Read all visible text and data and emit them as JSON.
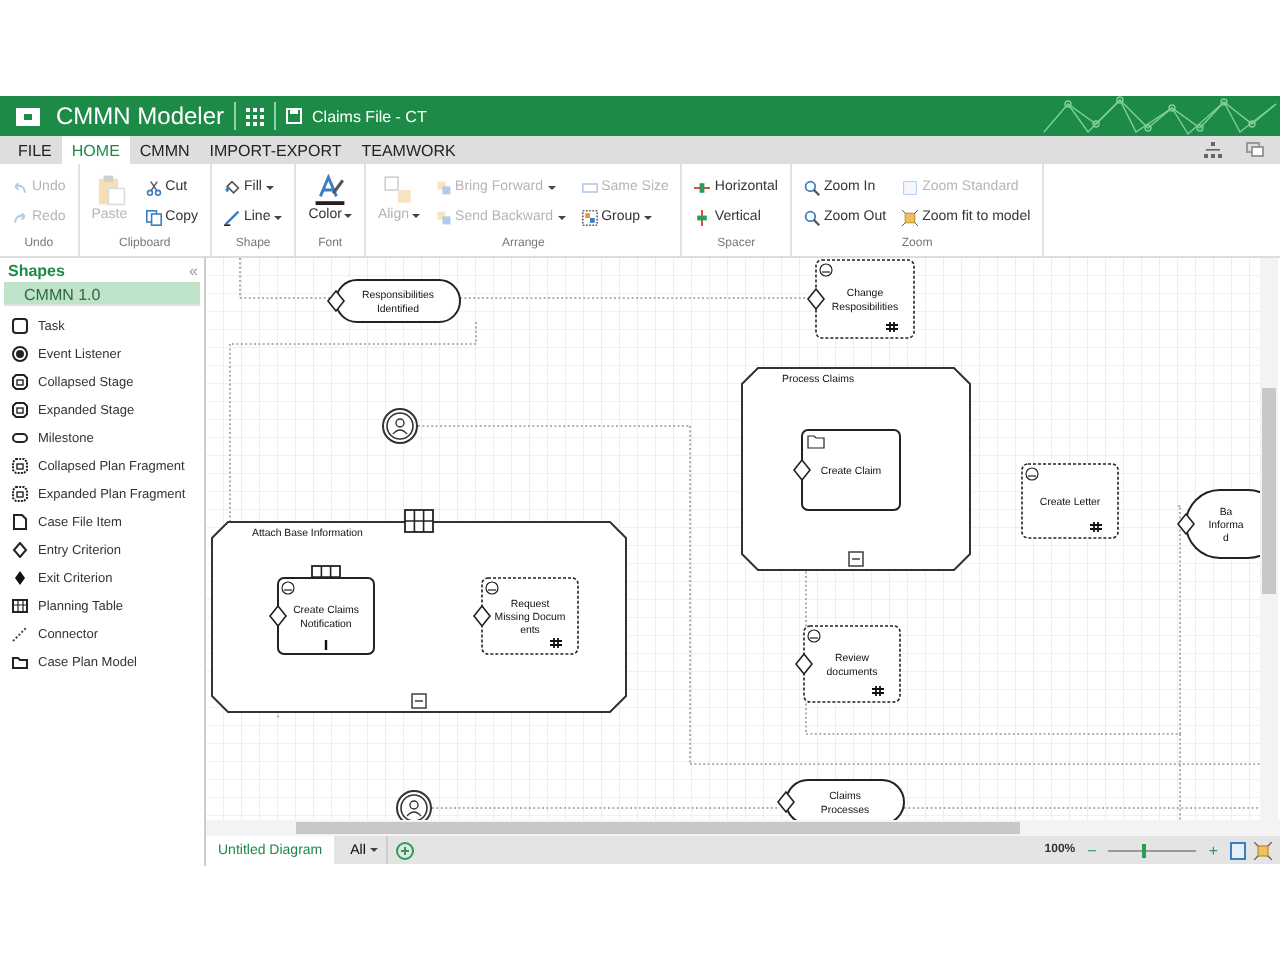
{
  "app": {
    "title": "CMMN Modeler",
    "document": "Claims File - CT"
  },
  "menu": [
    {
      "label": "FILE",
      "selected": false
    },
    {
      "label": "HOME",
      "selected": true
    },
    {
      "label": "CMMN",
      "selected": false
    },
    {
      "label": "IMPORT-EXPORT",
      "selected": false
    },
    {
      "label": "TEAMWORK",
      "selected": false
    }
  ],
  "ribbon": [
    {
      "label": "Undo",
      "columns": [
        [
          {
            "label": "Undo",
            "kind": "small",
            "dropdown": false,
            "disabled": true
          },
          {
            "label": "Redo",
            "kind": "small",
            "dropdown": false,
            "disabled": true
          }
        ]
      ]
    },
    {
      "label": "Clipboard",
      "columns": [
        [
          {
            "label": "Paste",
            "kind": "large",
            "dropdown": false,
            "disabled": true
          }
        ],
        [
          {
            "label": "Cut",
            "kind": "small",
            "dropdown": false,
            "disabled": false
          },
          {
            "label": "Copy",
            "kind": "small",
            "dropdown": false,
            "disabled": false
          }
        ]
      ]
    },
    {
      "label": "Shape",
      "columns": [
        [
          {
            "label": "Fill",
            "kind": "small",
            "dropdown": true,
            "disabled": false
          },
          {
            "label": "Line",
            "kind": "small",
            "dropdown": true,
            "disabled": false
          }
        ]
      ]
    },
    {
      "label": "Font",
      "columns": [
        [
          {
            "label": "Color",
            "kind": "large",
            "dropdown": true,
            "disabled": false
          }
        ]
      ]
    },
    {
      "label": "Arrange",
      "columns": [
        [
          {
            "label": "Align",
            "kind": "large",
            "dropdown": true,
            "disabled": true
          }
        ],
        [
          {
            "label": "Bring Forward",
            "kind": "small",
            "dropdown": true,
            "disabled": true
          },
          {
            "label": "Send Backward",
            "kind": "small",
            "dropdown": true,
            "disabled": true
          }
        ],
        [
          {
            "label": "Same Size",
            "kind": "small",
            "dropdown": false,
            "disabled": true
          },
          {
            "label": "Group",
            "kind": "small",
            "dropdown": true,
            "disabled": false
          }
        ]
      ]
    },
    {
      "label": "Spacer",
      "columns": [
        [
          {
            "label": "Horizontal",
            "kind": "small",
            "dropdown": false,
            "disabled": false
          },
          {
            "label": "Vertical",
            "kind": "small",
            "dropdown": false,
            "disabled": false
          }
        ]
      ]
    },
    {
      "label": "Zoom",
      "columns": [
        [
          {
            "label": "Zoom In",
            "kind": "small",
            "dropdown": false,
            "disabled": false
          },
          {
            "label": "Zoom Out",
            "kind": "small",
            "dropdown": false,
            "disabled": false
          }
        ],
        [
          {
            "label": "Zoom Standard",
            "kind": "small",
            "dropdown": false,
            "disabled": true
          },
          {
            "label": "Zoom fit to model",
            "kind": "small",
            "dropdown": false,
            "disabled": false
          }
        ]
      ]
    }
  ],
  "sidebar": {
    "title": "Shapes",
    "collapse": "«",
    "section": {
      "label": "CMMN 1.0"
    },
    "items": [
      {
        "label": "Task"
      },
      {
        "label": "Event Listener"
      },
      {
        "label": "Collapsed Stage"
      },
      {
        "label": "Expanded Stage"
      },
      {
        "label": "Milestone"
      },
      {
        "label": "Collapsed Plan Fragment"
      },
      {
        "label": "Expanded Plan Fragment"
      },
      {
        "label": "Case File Item"
      },
      {
        "label": "Entry Criterion"
      },
      {
        "label": "Exit Criterion"
      },
      {
        "label": "Planning Table"
      },
      {
        "label": "Connector"
      },
      {
        "label": "Case Plan Model"
      }
    ]
  },
  "canvas": {
    "nodes": [
      {
        "kind": "milestone",
        "lines": [
          "Responsibilities",
          "Identified"
        ],
        "entry": true
      },
      {
        "kind": "task",
        "lines": [
          "Change",
          "Resposibilities"
        ],
        "human": true,
        "discretionary": true,
        "repetition": true,
        "required": false,
        "planning_table": false,
        "entry": true
      },
      {
        "kind": "event"
      },
      {
        "kind": "stage",
        "lines": [
          "Process Claims"
        ],
        "collapsed": false,
        "planning_table": false
      },
      {
        "kind": "task",
        "lines": [
          "Create Claim"
        ],
        "human": false,
        "discretionary": false,
        "repetition": false,
        "required": false,
        "planning_table": false,
        "entry": true
      },
      {
        "kind": "stage",
        "lines": [
          "Attach Base Information"
        ],
        "collapsed": false,
        "planning_table": true
      },
      {
        "kind": "task",
        "lines": [
          "Create Claims",
          "Notification"
        ],
        "human": true,
        "discretionary": false,
        "repetition": false,
        "required": true,
        "planning_table": true,
        "entry": true
      },
      {
        "kind": "task",
        "lines": [
          "Request",
          "Missing Docum",
          "ents"
        ],
        "human": true,
        "discretionary": true,
        "repetition": true,
        "required": false,
        "planning_table": false,
        "entry": true
      },
      {
        "kind": "task",
        "lines": [
          "Create Letter"
        ],
        "human": true,
        "discretionary": true,
        "repetition": true,
        "required": false,
        "planning_table": false,
        "entry": false
      },
      {
        "kind": "milestone",
        "lines": [
          "Ba",
          "Informa",
          "d"
        ],
        "entry": true
      },
      {
        "kind": "task",
        "lines": [
          "Review",
          "documents"
        ],
        "human": true,
        "discretionary": true,
        "repetition": true,
        "required": false,
        "planning_table": false,
        "entry": true
      },
      {
        "kind": "event"
      },
      {
        "kind": "milestone",
        "lines": [
          "Claims",
          "Processes"
        ],
        "entry": true
      }
    ]
  },
  "bottom": {
    "tabs": [
      {
        "label": "Untitled Diagram",
        "selected": true
      }
    ],
    "filter": "All",
    "zoom": "100%",
    "minus": "−",
    "plus": "+",
    "level": 0.38
  }
}
